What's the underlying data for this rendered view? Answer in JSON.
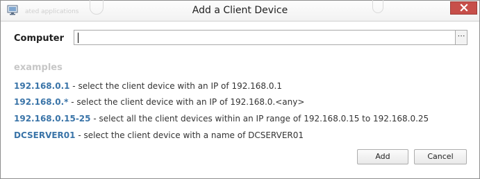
{
  "window": {
    "title": "Add a Client Device",
    "background_hint": "ated applications"
  },
  "form": {
    "computer_label": "Computer",
    "computer_value": "",
    "browse_label": "⋯"
  },
  "examples": {
    "heading": "examples",
    "items": [
      {
        "pattern": "192.168.0.1",
        "description": " - select the client device with an IP of 192.168.0.1"
      },
      {
        "pattern": "192.168.0.*",
        "description": " - select the client device with an IP of 192.168.0.<any>"
      },
      {
        "pattern": "192.168.0.15-25",
        "description": " - select all the client devices within an IP range of 192.168.0.15 to 192.168.0.25"
      },
      {
        "pattern": "DCSERVER01",
        "description": " - select the client device with a name of DCSERVER01"
      }
    ]
  },
  "buttons": {
    "add_label": "Add",
    "cancel_label": "Cancel"
  },
  "colors": {
    "pattern_blue": "#3a74a8",
    "close_red": "#c74f4a"
  }
}
